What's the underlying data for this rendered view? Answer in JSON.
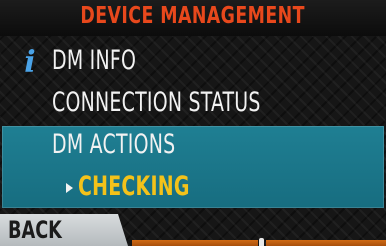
{
  "header": {
    "title": "DEVICE MANAGEMENT"
  },
  "menu": {
    "items": [
      {
        "label": "DM INFO",
        "icon": "info-icon"
      },
      {
        "label": "CONNECTION STATUS"
      },
      {
        "label": "DM ACTIONS",
        "selected": true
      }
    ],
    "selected_sub_item": {
      "label": "CHECKING"
    }
  },
  "softkeys": {
    "back_label": "BACK"
  },
  "colors": {
    "title": "#e8481c",
    "menu_text": "#f2f2f2",
    "selection_background": "#1f7f93",
    "sub_item_text": "#f3c21a",
    "info_icon": "#4aa3e8",
    "softkey_accent": "#d06a14"
  }
}
